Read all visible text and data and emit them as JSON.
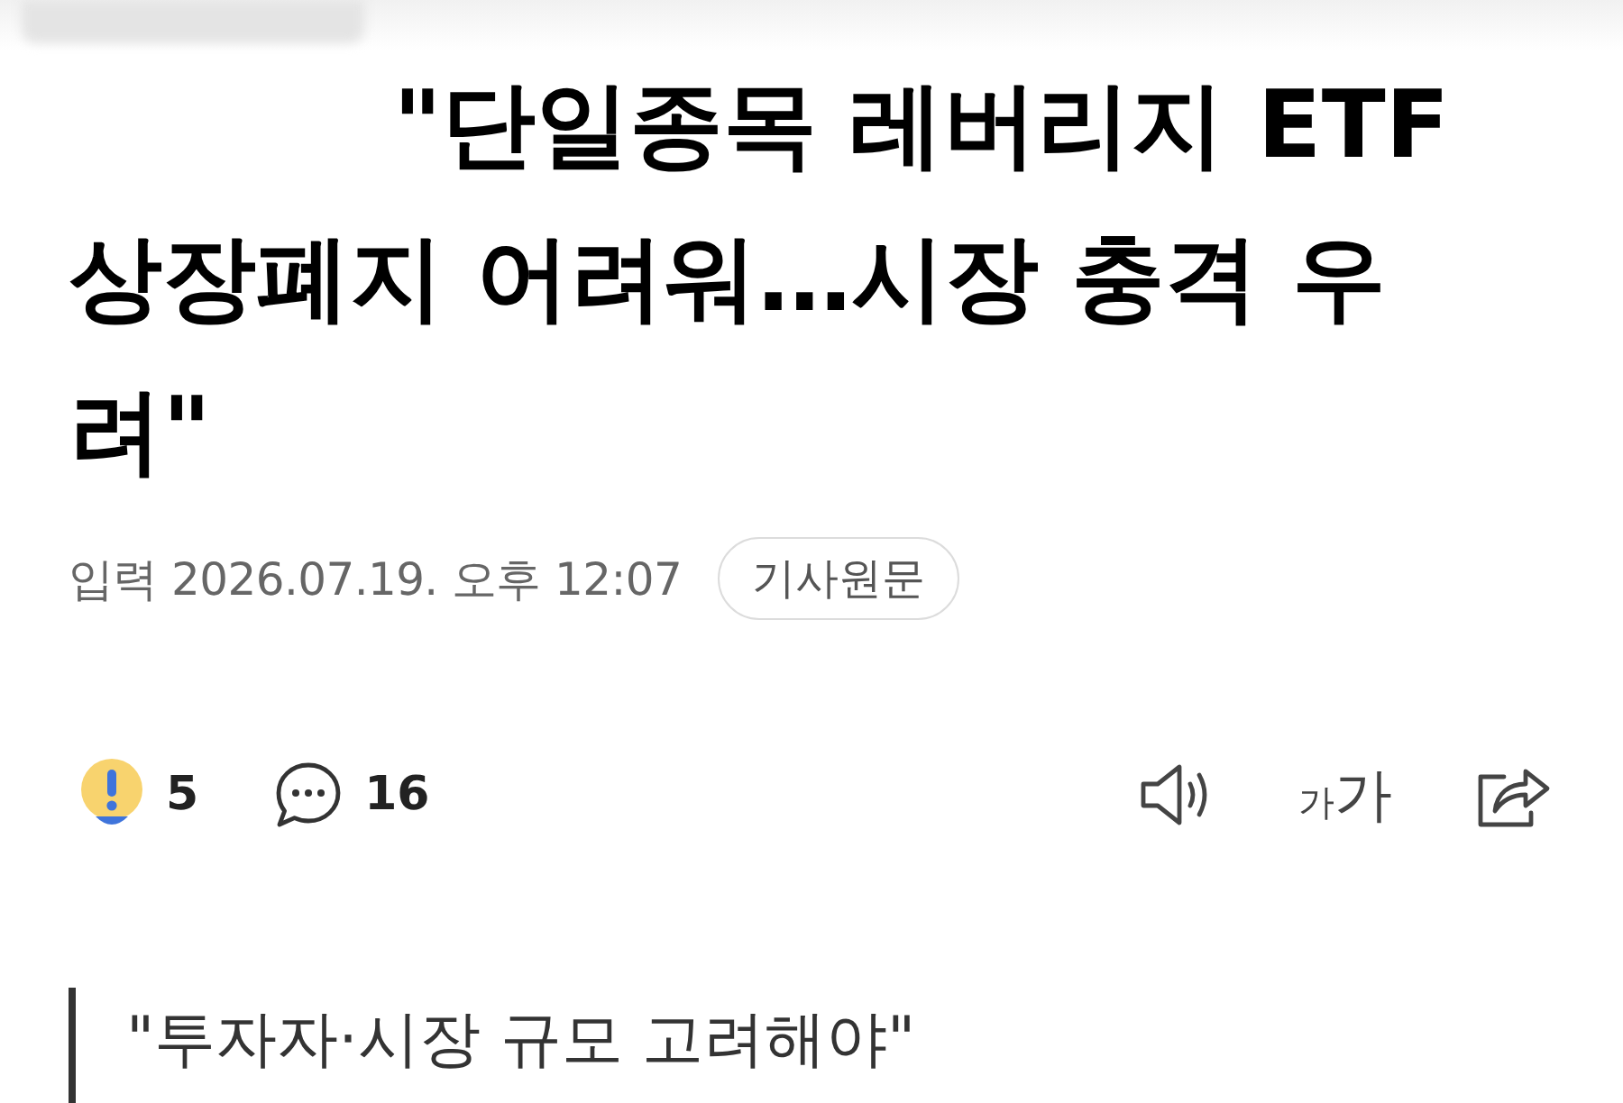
{
  "headline": "\"단일종목 레버리지 ETF 상장폐지 어려워…시장 충격 우려\"",
  "meta": {
    "published": "입력 2026.07.19. 오후 12:07",
    "original_button": "기사원문"
  },
  "actions": {
    "reaction_count": "5",
    "comment_count": "16",
    "font_size_button": {
      "small": "가",
      "large": "가"
    }
  },
  "subheading": "\"투자자·시장 규모 고려해야\""
}
